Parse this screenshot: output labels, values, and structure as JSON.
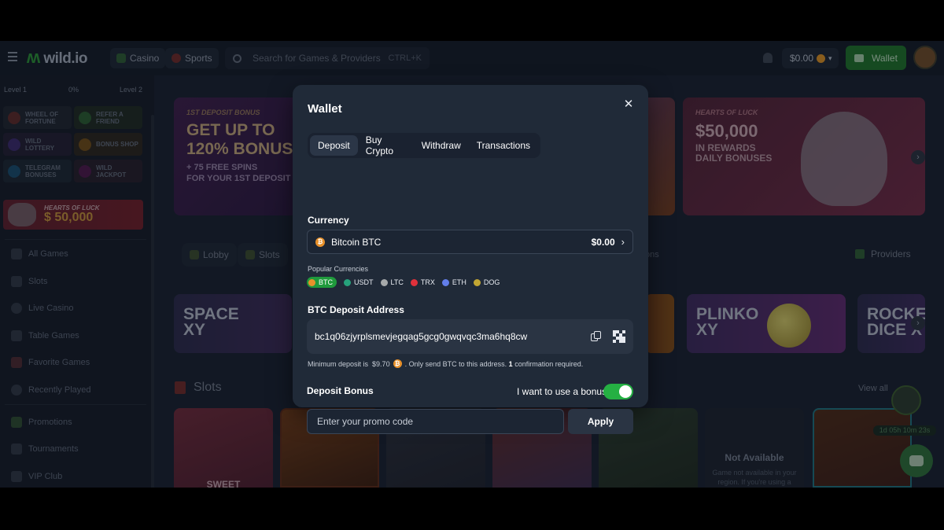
{
  "header": {
    "logo": "wild.io",
    "nav": [
      {
        "label": "Casino"
      },
      {
        "label": "Sports"
      }
    ],
    "search_placeholder": "Search for Games & Providers",
    "search_shortcut": "CTRL+K",
    "balance": "$0.00",
    "wallet_label": "Wallet"
  },
  "sidebar": {
    "level_left": "Level 1",
    "level_pct": "0%",
    "level_right": "Level 2",
    "tiles": [
      {
        "label": "WHEEL OF FORTUNE",
        "color": "#5a2a2a"
      },
      {
        "label": "REFER A FRIEND",
        "color": "#2a5a32"
      },
      {
        "label": "WILD LOTTERY",
        "color": "#3a2a6a"
      },
      {
        "label": "BONUS SHOP",
        "color": "#6a4a1a"
      },
      {
        "label": "TELEGRAM BONUSES",
        "color": "#1a4a6a"
      },
      {
        "label": "WILD JACKPOT",
        "color": "#4a1a4a"
      }
    ],
    "luck_banner": {
      "title": "HEARTS OF LUCK",
      "amount": "$ 50,000"
    },
    "items": [
      {
        "label": "All Games"
      },
      {
        "label": "Slots"
      },
      {
        "label": "Live Casino"
      },
      {
        "label": "Table Games"
      },
      {
        "label": "Favorite Games"
      },
      {
        "label": "Recently Played"
      },
      {
        "label": "Promotions"
      },
      {
        "label": "Tournaments"
      },
      {
        "label": "VIP Club"
      }
    ]
  },
  "promos": {
    "first": {
      "tag": "1ST DEPOSIT BONUS",
      "headline_1": "GET UP TO",
      "headline_2": "120% BONUS",
      "sub_1": "+ 75 FREE SPINS",
      "sub_2": "FOR YOUR 1ST DEPOSIT"
    },
    "luck": {
      "tag": "HEARTS OF LUCK",
      "amount": "$50,000",
      "sub_1": "IN REWARDS",
      "sub_2": "DAILY BONUSES"
    }
  },
  "lobby_tabs": [
    {
      "label": "Lobby"
    },
    {
      "label": "Slots"
    }
  ],
  "lobby_tab_partial": "ons",
  "providers_label": "Providers",
  "featured_games": [
    {
      "title_1": "SPACE",
      "title_2": "XY"
    },
    {
      "title_1": "PLINKO",
      "title_2": "XY"
    },
    {
      "title_1": "ROCKE",
      "title_2": "DICE X"
    }
  ],
  "slots_section": {
    "title": "Slots",
    "view_all": "View all",
    "first_card_text": "SWEET",
    "not_available_title": "Not Available",
    "not_available_text": "Game not available in your region. If you're using a",
    "timer": "1d 05h 10m 23s"
  },
  "wallet_modal": {
    "title": "Wallet",
    "close": "✕",
    "tabs": [
      {
        "label": "Deposit",
        "active": true
      },
      {
        "label": "Buy Crypto",
        "active": false
      },
      {
        "label": "Withdraw",
        "active": false
      },
      {
        "label": "Transactions",
        "active": false
      }
    ],
    "currency_label": "Currency",
    "currency_name": "Bitcoin BTC",
    "currency_amount": "$0.00",
    "popular_label": "Popular Currencies",
    "popular": [
      {
        "code": "BTC",
        "color": "#e8912b",
        "active": true
      },
      {
        "code": "USDT",
        "color": "#26a17b",
        "active": false
      },
      {
        "code": "LTC",
        "color": "#a6a9aa",
        "active": false
      },
      {
        "code": "TRX",
        "color": "#e0313b",
        "active": false
      },
      {
        "code": "ETH",
        "color": "#627eea",
        "active": false
      },
      {
        "code": "DOG",
        "color": "#c2a633",
        "active": false
      }
    ],
    "address_label": "BTC Deposit Address",
    "address": "bc1q06zjyrplsmevjegqag5gcg0gwqvqc3ma6hq8cw",
    "min_deposit_prefix": "Minimum deposit is",
    "min_deposit_amount": "$9.70",
    "min_deposit_suffix": ". Only send BTC to this address.",
    "confirmations": "1",
    "confirmations_suffix": "confirmation required.",
    "bonus_label": "Deposit Bonus",
    "bonus_toggle_label": "I want to use a bonus",
    "bonus_toggle_on": true,
    "promo_placeholder": "Enter your promo code",
    "apply_label": "Apply"
  }
}
